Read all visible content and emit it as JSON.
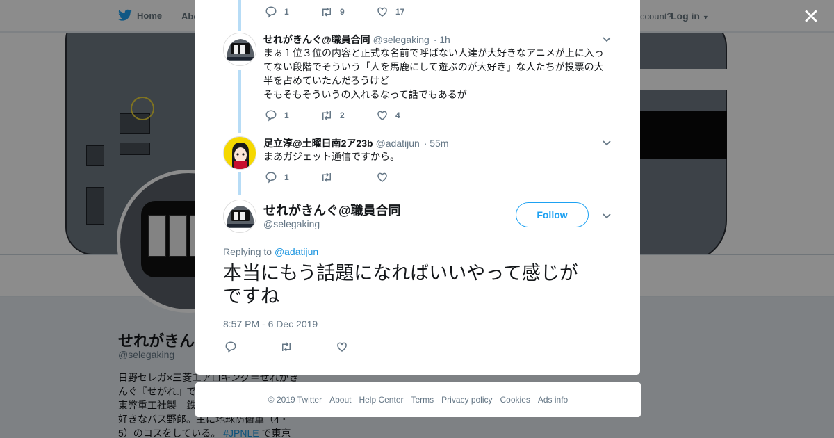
{
  "nav": {
    "home": "Home",
    "about": "Abo",
    "account_prompt": "ccount?",
    "login": "Log in"
  },
  "profile": {
    "name": "せれがきん",
    "handle": "@selegaking",
    "bio_lines": [
      "日野セレガ×三菱エアロキング＝せれがき",
      "んぐ『せがれ』で",
      "東弊重工社製　鉄",
      "好きなバス野郎。主に地球防衛軍（4・",
      "5）のコスをしている。"
    ],
    "bio_tag": "#JPNLE",
    "bio_tail": " で東京"
  },
  "thread": {
    "top_actions": {
      "replies": "1",
      "retweets": "9",
      "likes": "17"
    },
    "replies": [
      {
        "name": "せれがきんぐ@職員合同",
        "handle": "@selegaking",
        "time": "· 1h",
        "text_lines": [
          "まぁ１位３位の内容と正式な名前で呼ばない人達が大好きなアニメが上に入っ",
          "てない段階でそういう「人を馬鹿にして遊ぶのが大好き」な人たちが投票の大",
          "半を占めていたんだろうけど",
          "そもそもそういうの入れるなって話でもあるが"
        ],
        "actions": {
          "replies": "1",
          "retweets": "2",
          "likes": "4"
        }
      },
      {
        "name": "足立淳@土曜日南2ア23b",
        "handle": "@adatijun",
        "time": "· 55m",
        "text_lines": [
          "まあガジェット通信ですから。"
        ],
        "actions": {
          "replies": "1",
          "retweets": "",
          "likes": ""
        }
      }
    ],
    "main": {
      "name": "せれがきんぐ@職員合同",
      "handle": "@selegaking",
      "follow_label": "Follow",
      "replying_prefix": "Replying to ",
      "replying_to": "@adatijun",
      "text_line1": "本当にもう話題になればいいやって感じが",
      "text_line2": "ですね",
      "timestamp": "8:57 PM - 6 Dec 2019"
    }
  },
  "footer": {
    "links": [
      "© 2019 Twitter",
      "About",
      "Help Center",
      "Terms",
      "Privacy policy",
      "Cookies",
      "Ads info"
    ]
  },
  "colors": {
    "accent": "#1da1f2",
    "link": "#1b95e0",
    "thread_line": "#b7dcf6"
  },
  "icons": [
    "twitter-bird-icon",
    "close-icon",
    "reply-icon",
    "retweet-icon",
    "like-icon",
    "chevron-down-icon"
  ]
}
